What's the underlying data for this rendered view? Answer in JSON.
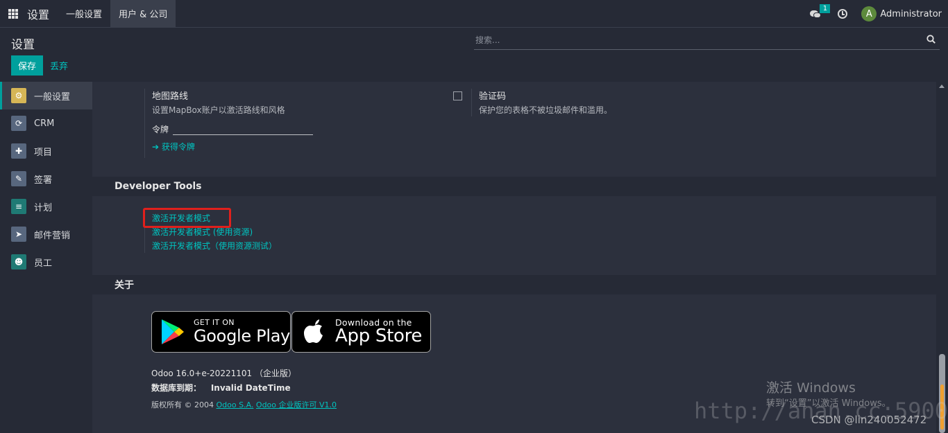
{
  "navbar": {
    "brand": "设置",
    "menu": [
      {
        "label": "一般设置",
        "active": false
      },
      {
        "label": "用户 & 公司",
        "active": true
      }
    ],
    "chat_count": "1",
    "user_initial": "A",
    "user_name": "Administrator"
  },
  "control_panel": {
    "title": "设置",
    "save_label": "保存",
    "discard_label": "丢弃",
    "search_placeholder": "搜索..."
  },
  "sidebar": {
    "items": [
      {
        "label": "一般设置",
        "icon": "gear-icon",
        "color": "#d6b656",
        "active": true
      },
      {
        "label": "CRM",
        "icon": "handshake-icon",
        "color": "#58677e",
        "active": false
      },
      {
        "label": "项目",
        "icon": "puzzle-icon",
        "color": "#58677e",
        "active": false
      },
      {
        "label": "签署",
        "icon": "sign-document-icon",
        "color": "#58677e",
        "active": false
      },
      {
        "label": "计划",
        "icon": "planning-icon",
        "color": "#1f7a74",
        "active": false
      },
      {
        "label": "邮件营销",
        "icon": "paper-plane-icon",
        "color": "#58677e",
        "active": false
      },
      {
        "label": "员工",
        "icon": "users-icon",
        "color": "#1f7a74",
        "active": false
      }
    ]
  },
  "map_routes": {
    "title": "地图路线",
    "description": "设置MapBox账户以激活路线和风格",
    "token_label": "令牌",
    "get_token_label": "获得令牌"
  },
  "captcha": {
    "title": "验证码",
    "description": "保护您的表格不被垃圾邮件和滥用。",
    "checked": false
  },
  "developer_tools": {
    "heading": "Developer Tools",
    "links": [
      "激活开发者模式",
      "激活开发者模式 (使用资源)",
      "激活开发者模式（使用资源测试）"
    ]
  },
  "about": {
    "heading": "关于",
    "google_play_small": "GET IT ON",
    "google_play_big": "Google Play",
    "app_store_small": "Download on the",
    "app_store_big": "App Store",
    "version": "Odoo 16.0+e-20221101 （企业版）",
    "expiry_label": "数据库到期：",
    "expiry_value": "Invalid DateTime",
    "copyright_prefix": "版权所有 © 2004",
    "company_link": "Odoo S.A.",
    "license_link": "Odoo 企业版许可 V1.0"
  },
  "overlays": {
    "activate_title": "激活 Windows",
    "activate_sub": "转到“设置”以激活 Windows。",
    "url_watermark": "http://anan.cc:5900",
    "csdn_watermark": "CSDN @lin240052472"
  }
}
